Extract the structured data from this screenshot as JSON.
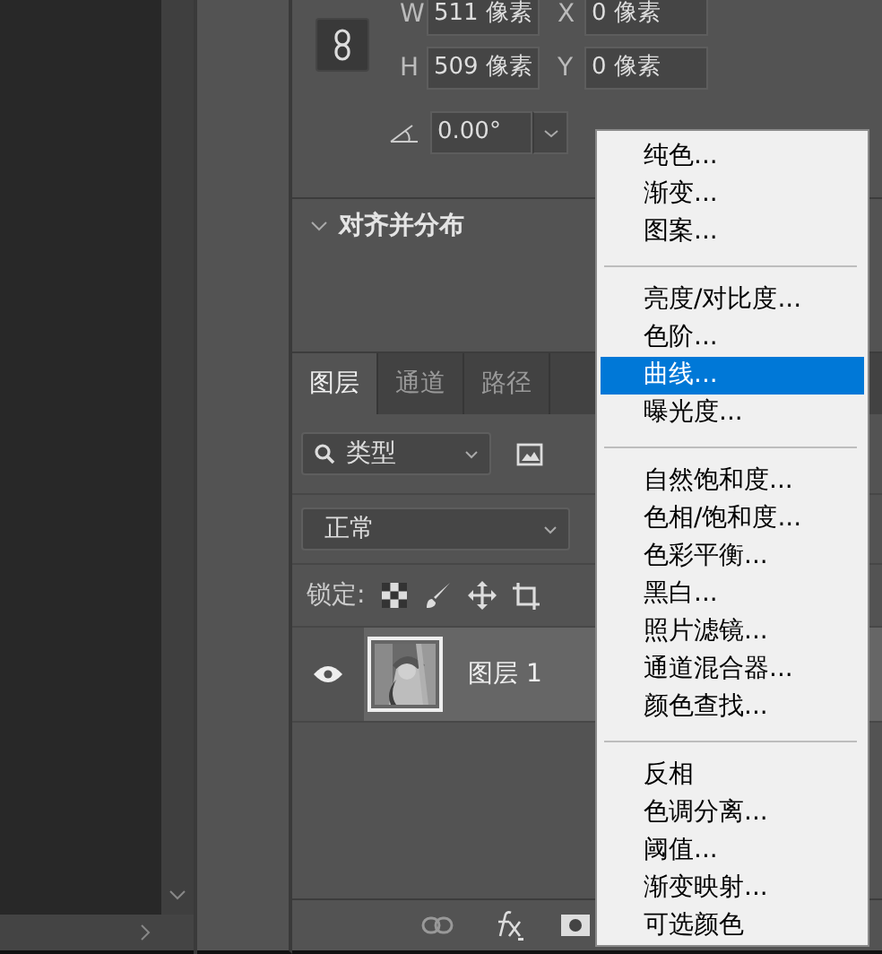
{
  "properties": {
    "width_label": "W",
    "width_value": "511 像素",
    "x_label": "X",
    "x_value": "0 像素",
    "height_label": "H",
    "height_value": "509 像素",
    "y_label": "Y",
    "y_value": "0 像素",
    "angle_value": "0.00°"
  },
  "align_section": {
    "title": "对齐并分布",
    "expanded": true
  },
  "layers_panel": {
    "tabs": [
      {
        "label": "图层",
        "selected": true
      },
      {
        "label": "通道",
        "selected": false
      },
      {
        "label": "路径",
        "selected": false
      }
    ],
    "filter": {
      "value": "类型"
    },
    "blend_mode": {
      "value": "正常"
    },
    "lock_label": "锁定:",
    "layers": [
      {
        "name": "图层 1",
        "visible": true,
        "kind": "picture"
      }
    ]
  },
  "adjustment_menu": {
    "groups": [
      [
        {
          "label": "纯色...",
          "selected": false
        },
        {
          "label": "渐变...",
          "selected": false
        },
        {
          "label": "图案...",
          "selected": false
        }
      ],
      [
        {
          "label": "亮度/对比度...",
          "selected": false
        },
        {
          "label": "色阶...",
          "selected": false
        },
        {
          "label": "曲线...",
          "selected": true
        },
        {
          "label": "曝光度...",
          "selected": false
        }
      ],
      [
        {
          "label": "自然饱和度...",
          "selected": false
        },
        {
          "label": "色相/饱和度...",
          "selected": false
        },
        {
          "label": "色彩平衡...",
          "selected": false
        },
        {
          "label": "黑白...",
          "selected": false
        },
        {
          "label": "照片滤镜...",
          "selected": false
        },
        {
          "label": "通道混合器...",
          "selected": false
        },
        {
          "label": "颜色查找...",
          "selected": false
        }
      ],
      [
        {
          "label": "反相",
          "selected": false
        },
        {
          "label": "色调分离...",
          "selected": false
        },
        {
          "label": "阈值...",
          "selected": false
        },
        {
          "label": "渐变映射...",
          "selected": false
        },
        {
          "label": "可选颜色",
          "selected": false
        }
      ]
    ]
  }
}
